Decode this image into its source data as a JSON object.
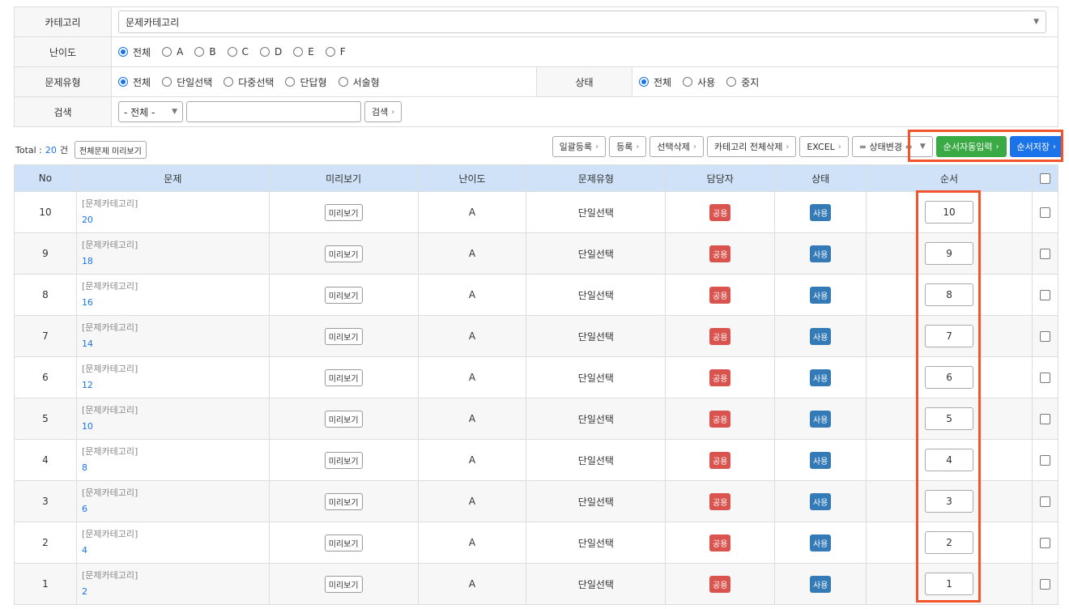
{
  "filter": {
    "category_label": "카테고리",
    "category_value": "문제카테고리",
    "difficulty_label": "난이도",
    "difficulty_options": [
      "전체",
      "A",
      "B",
      "C",
      "D",
      "E",
      "F"
    ],
    "type_label": "문제유형",
    "type_options": [
      "전체",
      "단일선택",
      "다중선택",
      "단답형",
      "서술형"
    ],
    "status_label": "상태",
    "status_options": [
      "전체",
      "사용",
      "중지"
    ],
    "search_label": "검색",
    "search_scope": "- 전체 -",
    "search_value": "",
    "search_button": "검색"
  },
  "toolbar": {
    "total_label": "Total :",
    "total_count": "20",
    "total_unit": "건",
    "preview_all": "전체문제 미리보기",
    "bulk_register": "일괄등록",
    "register": "등록",
    "delete_selected": "선택삭제",
    "delete_category_all": "카테고리 전체삭제",
    "excel": "EXCEL",
    "status_change": "= 상태변경 =",
    "auto_order": "순서자동입력",
    "save_order": "순서저장"
  },
  "table": {
    "headers": [
      "No",
      "문제",
      "미리보기",
      "난이도",
      "문제유형",
      "담당자",
      "상태",
      "순서"
    ],
    "rows": [
      {
        "no": "10",
        "cat": "[문제카테고리]",
        "q": "20",
        "preview": "미리보기",
        "diff": "A",
        "type": "단일선택",
        "owner": "공용",
        "status": "사용",
        "order": "10"
      },
      {
        "no": "9",
        "cat": "[문제카테고리]",
        "q": "18",
        "preview": "미리보기",
        "diff": "A",
        "type": "단일선택",
        "owner": "공용",
        "status": "사용",
        "order": "9"
      },
      {
        "no": "8",
        "cat": "[문제카테고리]",
        "q": "16",
        "preview": "미리보기",
        "diff": "A",
        "type": "단일선택",
        "owner": "공용",
        "status": "사용",
        "order": "8"
      },
      {
        "no": "7",
        "cat": "[문제카테고리]",
        "q": "14",
        "preview": "미리보기",
        "diff": "A",
        "type": "단일선택",
        "owner": "공용",
        "status": "사용",
        "order": "7"
      },
      {
        "no": "6",
        "cat": "[문제카테고리]",
        "q": "12",
        "preview": "미리보기",
        "diff": "A",
        "type": "단일선택",
        "owner": "공용",
        "status": "사용",
        "order": "6"
      },
      {
        "no": "5",
        "cat": "[문제카테고리]",
        "q": "10",
        "preview": "미리보기",
        "diff": "A",
        "type": "단일선택",
        "owner": "공용",
        "status": "사용",
        "order": "5"
      },
      {
        "no": "4",
        "cat": "[문제카테고리]",
        "q": "8",
        "preview": "미리보기",
        "diff": "A",
        "type": "단일선택",
        "owner": "공용",
        "status": "사용",
        "order": "4"
      },
      {
        "no": "3",
        "cat": "[문제카테고리]",
        "q": "6",
        "preview": "미리보기",
        "diff": "A",
        "type": "단일선택",
        "owner": "공용",
        "status": "사용",
        "order": "3"
      },
      {
        "no": "2",
        "cat": "[문제카테고리]",
        "q": "4",
        "preview": "미리보기",
        "diff": "A",
        "type": "단일선택",
        "owner": "공용",
        "status": "사용",
        "order": "2"
      },
      {
        "no": "1",
        "cat": "[문제카테고리]",
        "q": "2",
        "preview": "미리보기",
        "diff": "A",
        "type": "단일선택",
        "owner": "공용",
        "status": "사용",
        "order": "1"
      }
    ]
  },
  "colors": {
    "highlight": "#f2542d",
    "accent": "#1a73e8",
    "green": "#3aaa45",
    "badge_red": "#d9534f",
    "badge_blue": "#337ab7"
  }
}
